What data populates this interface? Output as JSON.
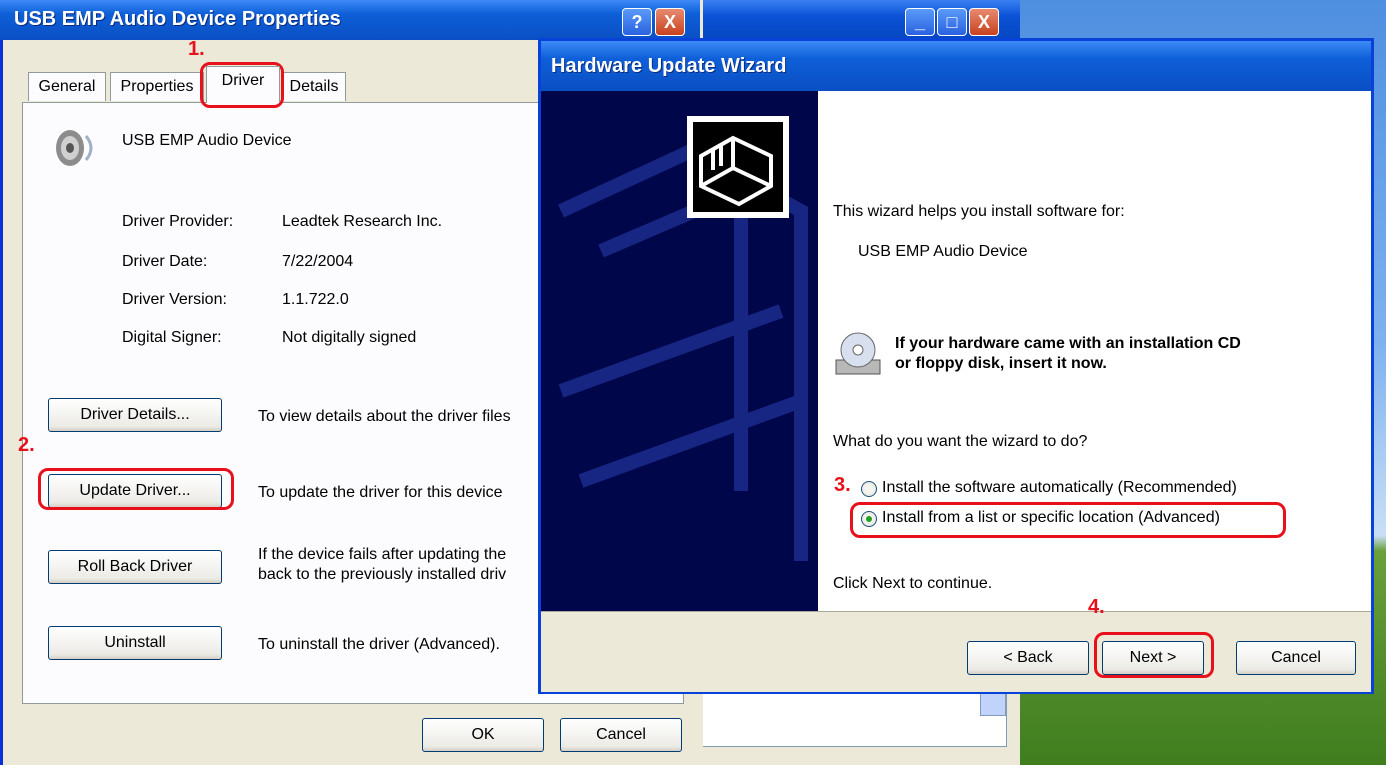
{
  "colors": {
    "annotation": "#e8101a",
    "xp_title": "#0a4fc4",
    "dialog_bg": "#ece9d8"
  },
  "props": {
    "title": "USB EMP Audio Device Properties",
    "tabs": [
      "General",
      "Properties",
      "Driver",
      "Details"
    ],
    "device_name": "USB EMP Audio Device",
    "info": [
      {
        "label": "Driver Provider:",
        "value": "Leadtek Research Inc."
      },
      {
        "label": "Driver Date:",
        "value": "7/22/2004"
      },
      {
        "label": "Driver Version:",
        "value": "1.1.722.0"
      },
      {
        "label": "Digital Signer:",
        "value": "Not digitally signed"
      }
    ],
    "buttons": {
      "details": "Driver Details...",
      "update": "Update Driver...",
      "rollback": "Roll Back Driver",
      "uninstall": "Uninstall",
      "ok": "OK",
      "cancel": "Cancel"
    },
    "desc": {
      "details": "To view details about the driver files",
      "update": "To update the driver for this device",
      "rollback_1": "If the device fails after updating the",
      "rollback_2": "back to the previously installed driv",
      "uninstall": "To uninstall the driver (Advanced)."
    }
  },
  "wizard": {
    "title": "Hardware Update Wizard",
    "intro": "This wizard helps you install software for:",
    "device": "USB EMP Audio Device",
    "cd_1": "If your hardware came with an installation CD",
    "cd_2": "or floppy disk, insert it now.",
    "question": "What do you want the wizard to do?",
    "options": [
      {
        "label": "Install the software automatically (Recommended)",
        "selected": false
      },
      {
        "label": "Install from a list or specific location (Advanced)",
        "selected": true
      }
    ],
    "hint": "Click Next to continue.",
    "back": "< Back",
    "next": "Next >",
    "cancel": "Cancel"
  },
  "annotations": [
    "1.",
    "2.",
    "3.",
    "4."
  ],
  "icons": {
    "help": "?",
    "close": "X",
    "minimize": "_",
    "maximize": "□"
  }
}
